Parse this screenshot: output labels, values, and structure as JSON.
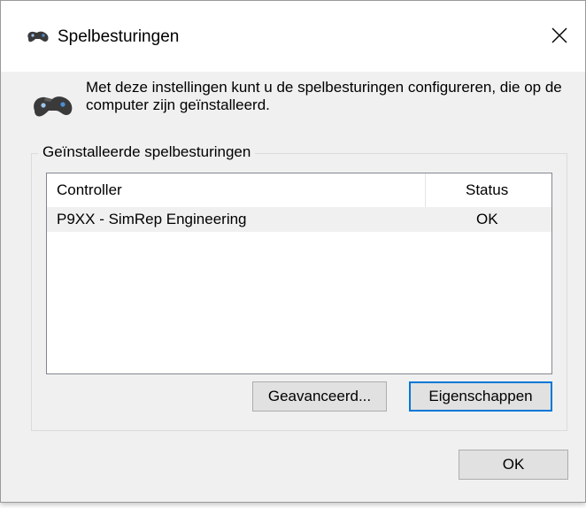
{
  "window": {
    "title": "Spelbesturingen",
    "icon": "gamepad-icon",
    "close_icon": "close-icon"
  },
  "description": "Met deze instellingen kunt u de spelbesturingen configureren, die op de computer zijn geïnstalleerd.",
  "group": {
    "label": "Geïnstalleerde spelbesturingen",
    "columns": [
      "Controller",
      "Status"
    ],
    "rows": [
      {
        "controller": "P9XX - SimRep Engineering",
        "status": "OK"
      }
    ]
  },
  "buttons": {
    "advanced": "Geavanceerd...",
    "properties": "Eigenschappen",
    "ok": "OK"
  },
  "colors": {
    "accent": "#0078d7",
    "dialog_bg": "#f0f0f0",
    "selected_row": "#f0f0f0"
  }
}
